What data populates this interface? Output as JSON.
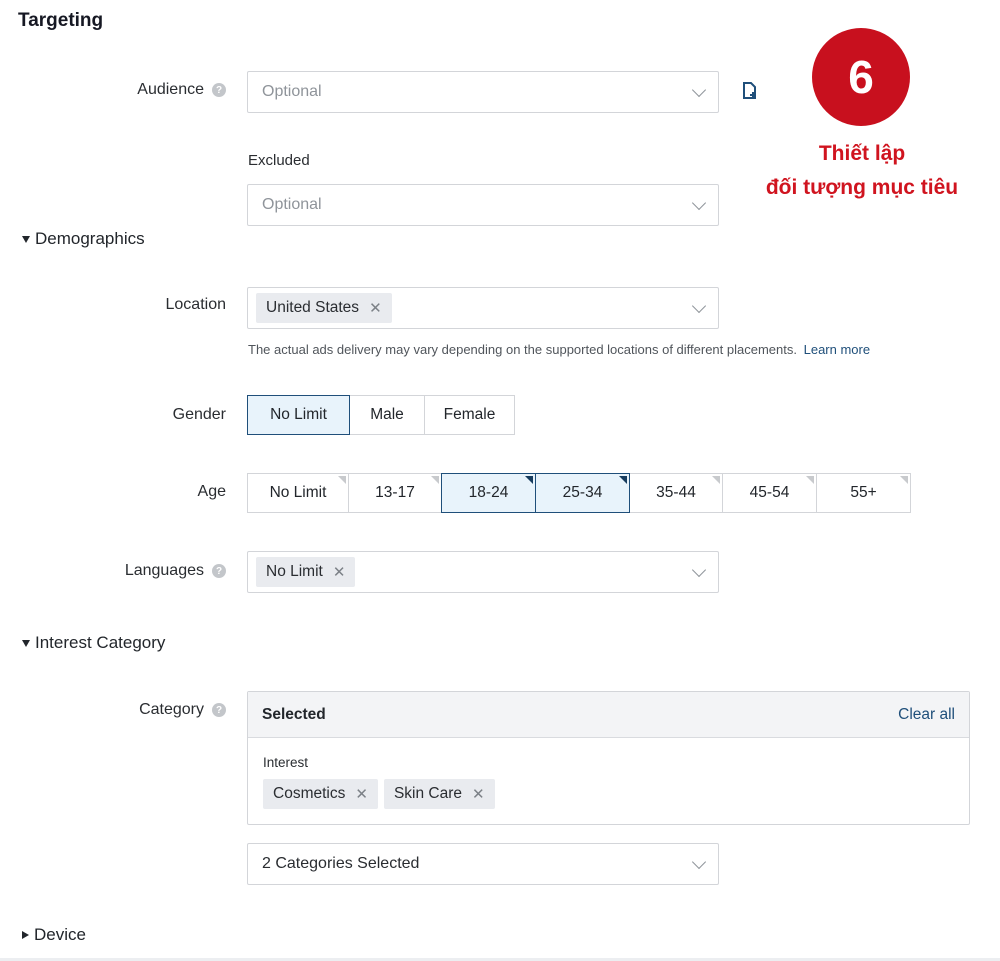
{
  "targeting": {
    "title": "Targeting",
    "audience": {
      "label": "Audience",
      "placeholder": "Optional"
    },
    "excluded": {
      "label": "Excluded",
      "placeholder": "Optional"
    }
  },
  "annotation": {
    "badge": "6",
    "line1": "Thiết lập",
    "line2": "đối tượng mục tiêu",
    "badge_color": "#c8101e"
  },
  "demographics": {
    "title": "Demographics",
    "location": {
      "label": "Location",
      "tags": [
        "United States"
      ],
      "note": "The actual ads delivery may vary depending on the supported locations of different placements.",
      "learn_more": "Learn more"
    },
    "gender": {
      "label": "Gender",
      "options": [
        "No Limit",
        "Male",
        "Female"
      ],
      "selected": "No Limit"
    },
    "age": {
      "label": "Age",
      "options": [
        "No Limit",
        "13-17",
        "18-24",
        "25-34",
        "35-44",
        "45-54",
        "55+"
      ],
      "selected": [
        "18-24",
        "25-34"
      ]
    },
    "languages": {
      "label": "Languages",
      "tags": [
        "No Limit"
      ]
    }
  },
  "interest_category": {
    "title": "Interest Category",
    "category": {
      "label": "Category",
      "selected_header": "Selected",
      "clear_all": "Clear all",
      "group_label": "Interest",
      "tags": [
        "Cosmetics",
        "Skin Care"
      ],
      "dropdown_value": "2 Categories Selected"
    }
  },
  "device": {
    "title": "Device"
  },
  "icons": {
    "help": "help-icon",
    "chevron": "chevron-down-icon",
    "remove": "close-icon",
    "file": "file-add-icon"
  },
  "colors": {
    "accent": "#1f4f7a",
    "selected_bg": "#e8f3fb",
    "annotation": "#d0141f"
  }
}
